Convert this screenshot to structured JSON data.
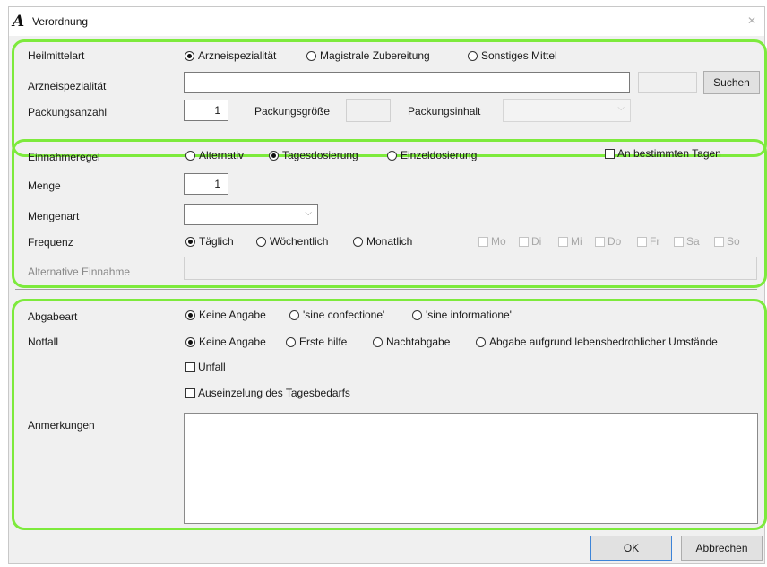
{
  "window": {
    "title": "Verordnung",
    "close_glyph": "✕",
    "app_icon": "A"
  },
  "section1": {
    "heilmittelart_label": "Heilmittelart",
    "heilmittelart_options": [
      {
        "label": "Arzneispezialität",
        "selected": true
      },
      {
        "label": "Magistrale Zubereitung",
        "selected": false
      },
      {
        "label": "Sonstiges Mittel",
        "selected": false
      }
    ],
    "arzneispezialitaet_label": "Arzneispezialität",
    "arzneispezialitaet_value": "",
    "search_button": "Suchen",
    "packungsanzahl_label": "Packungsanzahl",
    "packungsanzahl_value": "1",
    "packungsgroesse_label": "Packungsgröße",
    "packungsinhalt_label": "Packungsinhalt"
  },
  "section2": {
    "einnahmeregel_label": "Einnahmeregel",
    "einnahmeregel_options": [
      {
        "label": "Alternativ",
        "selected": false
      },
      {
        "label": "Tagesdosierung",
        "selected": true
      },
      {
        "label": "Einzeldosierung",
        "selected": false
      }
    ],
    "bestimmte_tage_label": "An bestimmten Tagen",
    "menge_label": "Menge",
    "menge_value": "1",
    "mengenart_label": "Mengenart",
    "frequenz_label": "Frequenz",
    "frequenz_options": [
      {
        "label": "Täglich",
        "selected": true
      },
      {
        "label": "Wöchentlich",
        "selected": false
      },
      {
        "label": "Monatlich",
        "selected": false
      }
    ],
    "weekdays": [
      "Mo",
      "Di",
      "Mi",
      "Do",
      "Fr",
      "Sa",
      "So"
    ],
    "alternative_label": "Alternative Einnahme"
  },
  "section3": {
    "abgabeart_label": "Abgabeart",
    "abgabeart_options": [
      {
        "label": "Keine Angabe",
        "selected": true
      },
      {
        "label": "'sine confectione'",
        "selected": false
      },
      {
        "label": "'sine informatione'",
        "selected": false
      }
    ],
    "notfall_label": "Notfall",
    "notfall_options": [
      {
        "label": "Keine Angabe",
        "selected": true
      },
      {
        "label": "Erste hilfe",
        "selected": false
      },
      {
        "label": "Nachtabgabe",
        "selected": false
      },
      {
        "label": "Abgabe aufgrund lebensbedrohlicher Umstände",
        "selected": false
      }
    ],
    "unfall_label": "Unfall",
    "auseinzelung_label": "Auseinzelung des Tagesbedarfs",
    "anmerkungen_label": "Anmerkungen",
    "anmerkungen_value": ""
  },
  "footer": {
    "ok_label": "OK",
    "cancel_label": "Abbrechen"
  },
  "colors": {
    "highlight": "#7dea3c",
    "primary_border": "#3c84d8"
  }
}
